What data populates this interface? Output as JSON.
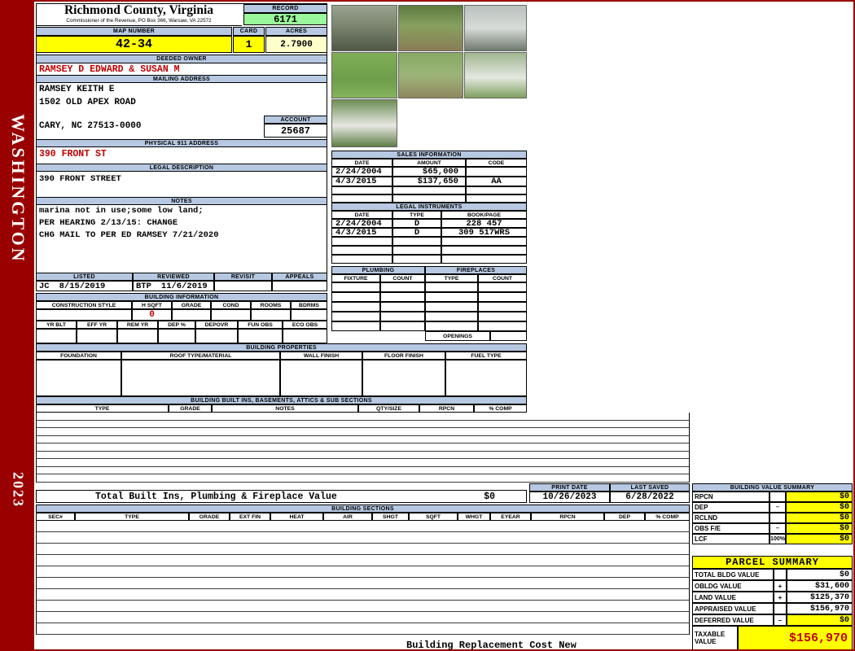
{
  "sidebar": {
    "county": "WASHINGTON",
    "year": "2023"
  },
  "header": {
    "title": "Richmond County, Virginia",
    "subtitle": "Commissioner of the Revenue, PO Box 366, Warsaw, VA 22572",
    "record_label": "RECORD",
    "record_value": "6171",
    "map_label": "MAP NUMBER",
    "map_value": "42-34",
    "card_label": "CARD",
    "card_value": "1",
    "acres_label": "ACRES",
    "acres_value": "2.7900"
  },
  "owner": {
    "deeded_label": "DEEDED OWNER",
    "deeded_name": "RAMSEY D EDWARD & SUSAN M",
    "mailing_label": "MAILING ADDRESS",
    "mailing_line1": "RAMSEY KEITH E",
    "mailing_line2": "1502 OLD APEX ROAD",
    "mailing_line3": "CARY, NC 27513-0000",
    "account_label": "ACCOUNT",
    "account_value": "25687",
    "physical_label": "PHYSICAL 911 ADDRESS",
    "physical_value": "390 FRONT ST",
    "legal_label": "LEGAL DESCRIPTION",
    "legal_value": "390 FRONT STREET",
    "notes_label": "NOTES",
    "notes_line1": "marina not in use;some low land;",
    "notes_line2": "PER HEARING 2/13/15: CHANGE",
    "notes_line3": "CHG MAIL TO PER ED RAMSEY 7/21/2020"
  },
  "sales": {
    "title": "SALES INFORMATION",
    "col_date": "DATE",
    "col_amount": "AMOUNT",
    "col_code": "CODE",
    "rows": [
      {
        "date": "2/24/2004",
        "amount": "$65,000",
        "code": ""
      },
      {
        "date": "4/3/2015",
        "amount": "$137,650",
        "code": "AA"
      }
    ]
  },
  "legal": {
    "title": "LEGAL INSTRUMENTS",
    "col_date": "DATE",
    "col_type": "TYPE",
    "col_book": "BOOK/PAGE",
    "rows": [
      {
        "date": "2/24/2004",
        "type": "D",
        "book": "228 457"
      },
      {
        "date": "4/3/2015",
        "type": "D",
        "book": "309 517WRS"
      }
    ]
  },
  "plumbing": {
    "title": "PLUMBING",
    "col_fixture": "FIXTURE",
    "col_count": "COUNT"
  },
  "fireplaces": {
    "title": "FIREPLACES",
    "col_type": "TYPE",
    "col_count": "COUNT",
    "openings_label": "OPENINGS"
  },
  "review": {
    "col_listed": "LISTED",
    "col_reviewed": "REVIEWED",
    "col_revisit": "REVISIT",
    "col_appeals": "APPEALS",
    "listed_by": "JC",
    "listed_date": "8/15/2019",
    "reviewed_by": "BTP",
    "reviewed_date": "11/6/2019"
  },
  "building_info": {
    "title": "BUILDING INFORMATION",
    "cols1": [
      "CONSTRUCTION STYLE",
      "H SQFT",
      "GRADE",
      "COND",
      "ROOMS",
      "BDRMS"
    ],
    "h_sqft": "0",
    "cols2": [
      "YR BLT",
      "EFF YR",
      "REM YR",
      "DEP %",
      "DEPOVR",
      "FUN OBS",
      "ECO OBS"
    ]
  },
  "building_properties": {
    "title": "BUILDING PROPERTIES",
    "cols": [
      "FOUNDATION",
      "ROOF TYPE/MATERIAL",
      "WALL FINISH",
      "FLOOR FINISH",
      "FUEL TYPE"
    ]
  },
  "built_ins": {
    "title": "BUILDING BUILT INS, BASEMENTS, ATTICS & SUB SECTIONS",
    "cols": [
      "TYPE",
      "GRADE",
      "NOTES",
      "QTY/SIZE",
      "RPCN",
      "% COMP"
    ],
    "total_label": "Total Built Ins, Plumbing & Fireplace Value",
    "total_value": "$0"
  },
  "dates": {
    "print_label": "PRINT DATE",
    "print_value": "10/26/2023",
    "saved_label": "LAST SAVED",
    "saved_value": "6/28/2022"
  },
  "bvs": {
    "title": "BUILDING VALUE SUMMARY",
    "rows": [
      {
        "label": "RPCN",
        "op": "",
        "value": "$0"
      },
      {
        "label": "DEP",
        "op": "–",
        "value": "$0"
      },
      {
        "label": "RCLND",
        "op": "",
        "value": "$0"
      },
      {
        "label": "OBS F/E",
        "op": "–",
        "value": "$0"
      },
      {
        "label": "LCF",
        "op": "100%",
        "value": "$0"
      }
    ]
  },
  "sections": {
    "title": "BUILDING SECTIONS",
    "cols": [
      "SEC#",
      "TYPE",
      "GRADE",
      "EXT FIN",
      "HEAT",
      "AIR",
      "SHGT",
      "SQFT",
      "WHGT",
      "EYEAR",
      "RPCN",
      "DEP",
      "% COMP"
    ]
  },
  "parcel": {
    "title": "PARCEL SUMMARY",
    "rows": [
      {
        "label": "TOTAL BLDG VALUE",
        "op": "",
        "value": "$0"
      },
      {
        "label": "OBLDG VALUE",
        "op": "+",
        "value": "$31,600"
      },
      {
        "label": "LAND VALUE",
        "op": "+",
        "value": "$125,370"
      },
      {
        "label": "APPRAISED VALUE",
        "op": "",
        "value": "$156,970"
      },
      {
        "label": "DEFERRED VALUE",
        "op": "–",
        "value": "$0"
      }
    ],
    "taxable_label": "TAXABLE VALUE",
    "taxable_value": "$156,970"
  },
  "footer": {
    "brcn": "Building Replacement Cost New"
  }
}
